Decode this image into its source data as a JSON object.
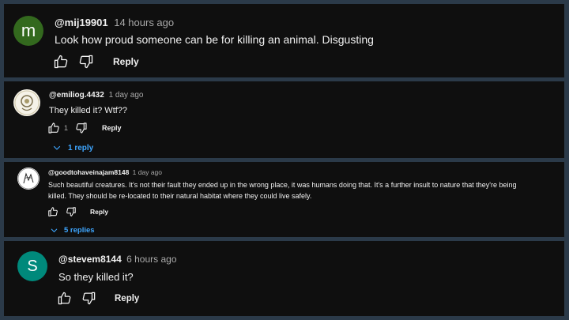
{
  "comments": [
    {
      "avatar_letter": "m",
      "avatar_color": "#33691e",
      "handle": "@mij19901",
      "time": "14 hours ago",
      "text": "Look how proud someone can be for killing an animal. Disgusting",
      "like_icon": "thumb-up-icon",
      "dislike_icon": "thumb-down-icon",
      "reply_label": "Reply"
    },
    {
      "avatar_icon": "emblem-avatar-image",
      "handle": "@emiliog.4432",
      "time": "1 day ago",
      "text": "They killed it? Wtf??",
      "like_count": "1",
      "reply_label": "Reply",
      "replies_label": "1 reply"
    },
    {
      "avatar_icon": "drawing-avatar-image",
      "handle": "@goodtohaveinajam8148",
      "time": "1 day ago",
      "text_line1": "Such beautiful creatures. It's not their fault they ended up in the wrong place, it was humans doing that. It's a further insult to nature that they're being",
      "text_line2": "killed. They should be re-located to their natural habitat where they could live safely.",
      "reply_label": "Reply",
      "replies_label": "5 replies"
    },
    {
      "avatar_letter": "S",
      "avatar_color": "#00897b",
      "handle": "@stevem8144",
      "time": "6 hours ago",
      "text": "So they killed it?",
      "reply_label": "Reply"
    }
  ],
  "colors": {
    "background": "#2b3a49",
    "panel": "#0f0f0f",
    "link_blue": "#3ea6ff"
  }
}
